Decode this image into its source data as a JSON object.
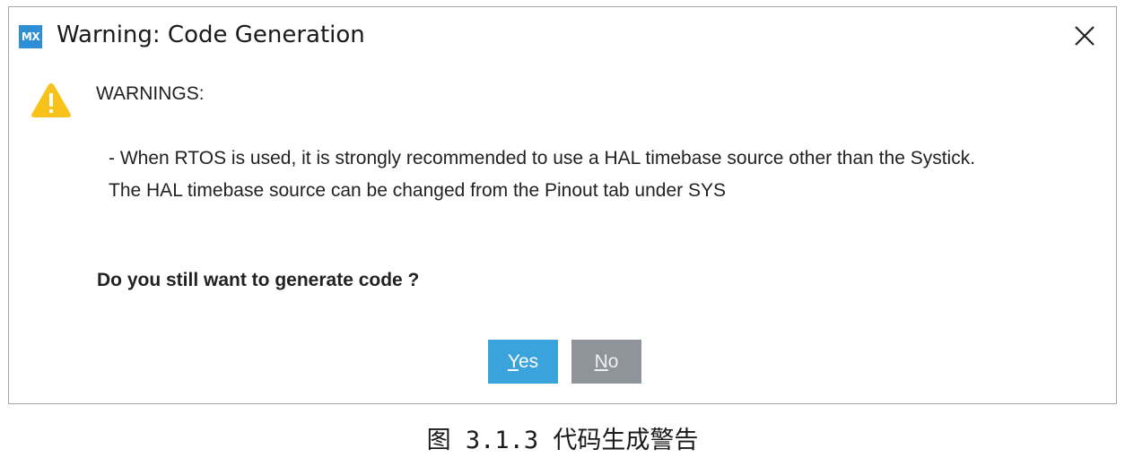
{
  "dialog": {
    "app_icon_text": "MX",
    "title": "Warning: Code Generation",
    "close_icon": "close-icon",
    "warning_icon": "warning-triangle-icon",
    "warnings_heading": "WARNINGS:",
    "message_lines": [
      "- When RTOS is used, it is strongly recommended to use a HAL timebase source other than the Systick.",
      "The HAL timebase source can be changed from the Pinout tab under SYS"
    ],
    "question": "Do you still want to generate code ?",
    "buttons": {
      "yes": {
        "mnemonic": "Y",
        "rest": "es"
      },
      "no": {
        "mnemonic": "N",
        "rest": "o"
      }
    },
    "colors": {
      "yes_button": "#3ba3dc",
      "no_button": "#8e9499",
      "warning_icon": "#f7c21a",
      "app_icon": "#2f8fd6"
    }
  },
  "caption": "图 3.1.3 代码生成警告"
}
